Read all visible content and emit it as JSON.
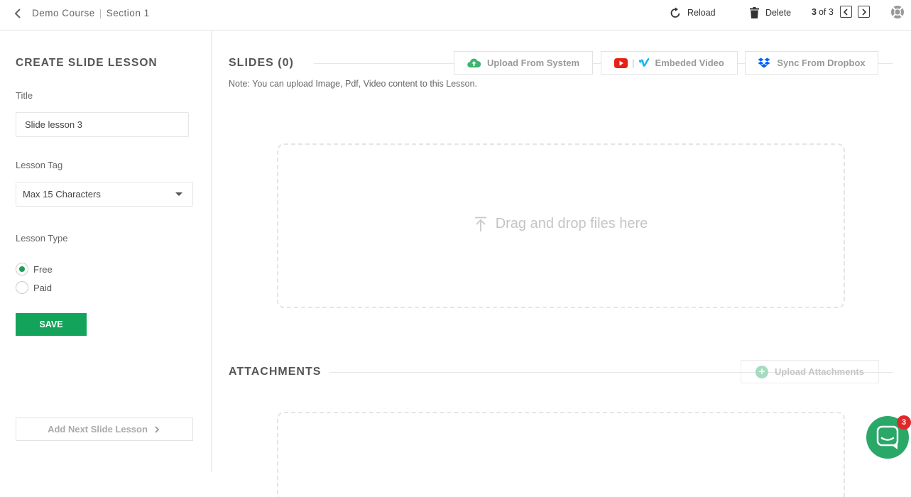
{
  "header": {
    "course": "Demo Course",
    "separator": "|",
    "section": "Section 1",
    "reload_label": "Reload",
    "delete_label": "Delete",
    "pager_current": "3",
    "pager_of": "of 3"
  },
  "sidebar": {
    "title": "CREATE SLIDE LESSON",
    "title_label": "Title",
    "title_value": "Slide lesson 3",
    "tag_label": "Lesson Tag",
    "tag_value": "Max 15 Characters",
    "type_label": "Lesson Type",
    "type_options": [
      "Free",
      "Paid"
    ],
    "selected_type": "Free",
    "save_label": "SAVE",
    "next_label": "Add Next Slide Lesson"
  },
  "slides": {
    "title": "SLIDES (0)",
    "upload_system": "Upload From System",
    "embed_separator": "|",
    "embed_video": "Embeded Video",
    "dropbox": "Sync From Dropbox",
    "note": "Note: You can upload Image, Pdf, Video content to this Lesson.",
    "drop_text": "Drag and drop files here"
  },
  "attachments": {
    "title": "ATTACHMENTS",
    "upload_label": "Upload Attachments"
  },
  "chat": {
    "badge_count": "3"
  },
  "colors": {
    "primary_green": "#14a35a",
    "youtube_red": "#e62117",
    "vimeo_blue": "#1ab7ea",
    "dropbox_blue": "#0061fe",
    "badge_red": "#e0292b"
  }
}
